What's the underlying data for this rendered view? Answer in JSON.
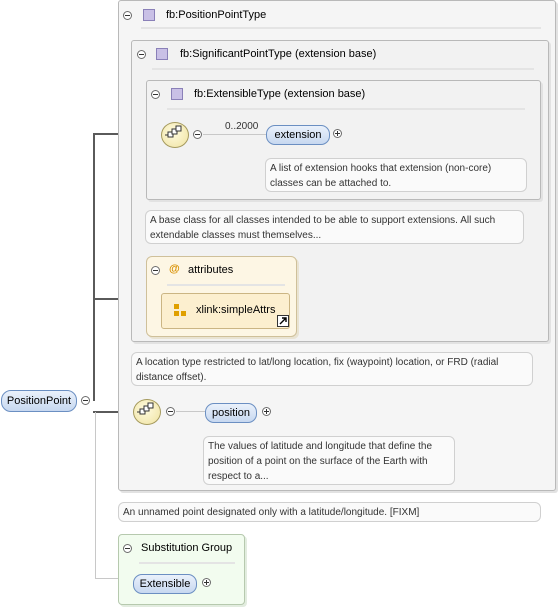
{
  "root_element": {
    "label": "PositionPoint"
  },
  "outer_type": {
    "title": "fb:PositionPointType"
  },
  "significant_type": {
    "title": "fb:SignificantPointType (extension base)"
  },
  "extensible_type": {
    "title": "fb:ExtensibleType (extension base)",
    "cardinality": "0..2000",
    "element": "extension",
    "element_doc": "A list of extension hooks that extension (non-core) classes can be attached to."
  },
  "significant_doc": "A base class for all classes intended to be able to support extensions. All such extendable classes must themselves...",
  "attributes": {
    "title": "attributes",
    "at_symbol": "@",
    "item": "xlink:simpleAttrs"
  },
  "position_type_doc": "A location type restricted to lat/long location, fix (waypoint) location, or FRD (radial distance offset).",
  "position_element": {
    "label": "position",
    "doc": "The values of latitude and longitude that define the position of a point on the surface of the Earth with respect to a..."
  },
  "root_doc": "An unnamed point designated only with a latitude/longitude. [FIXM]",
  "substitution_group": {
    "title": "Substitution Group",
    "member": "Extensible"
  },
  "colors": {
    "element_border": "#6b8fc2",
    "element_fill": "#c7d8f0",
    "attribute_box": "#fdf2d8",
    "substitution_box": "#eefbe8",
    "sequence_fill": "#efe2a0"
  }
}
